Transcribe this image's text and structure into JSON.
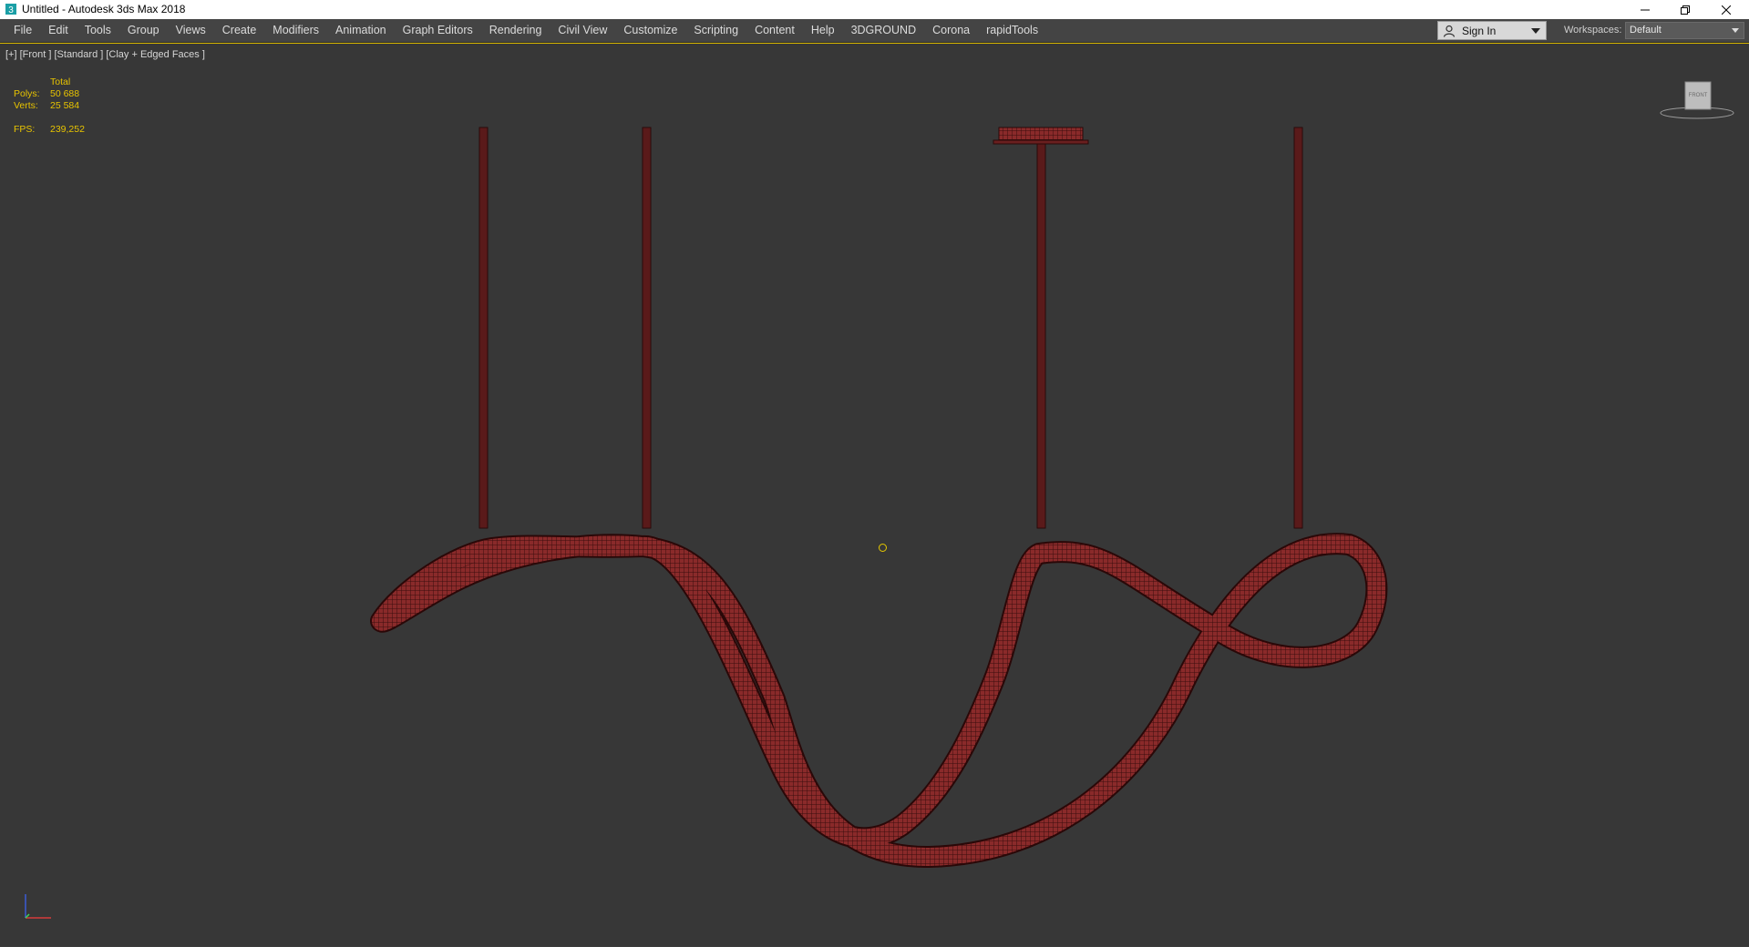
{
  "window": {
    "title": "Untitled - Autodesk 3ds Max 2018"
  },
  "menubar": {
    "items": [
      "File",
      "Edit",
      "Tools",
      "Group",
      "Views",
      "Create",
      "Modifiers",
      "Animation",
      "Graph Editors",
      "Rendering",
      "Civil View",
      "Customize",
      "Scripting",
      "Content",
      "Help",
      "3DGROUND",
      "Corona",
      "rapidTools"
    ],
    "sign_in_label": "Sign In",
    "workspaces_label": "Workspaces:",
    "workspaces_value": "Default"
  },
  "viewport": {
    "label": "[+] [Front ] [Standard ] [Clay + Edged Faces ]",
    "stats": {
      "total_label": "Total",
      "polys_label": "Polys:",
      "polys_value": "50 688",
      "verts_label": "Verts:",
      "verts_value": "25 584",
      "fps_label": "FPS:",
      "fps_value": "239,252"
    },
    "viewcube_label": "FRONT"
  },
  "colors": {
    "accent": "#d4b400",
    "model": "#8a2a2a",
    "viewport_bg": "#373737"
  }
}
